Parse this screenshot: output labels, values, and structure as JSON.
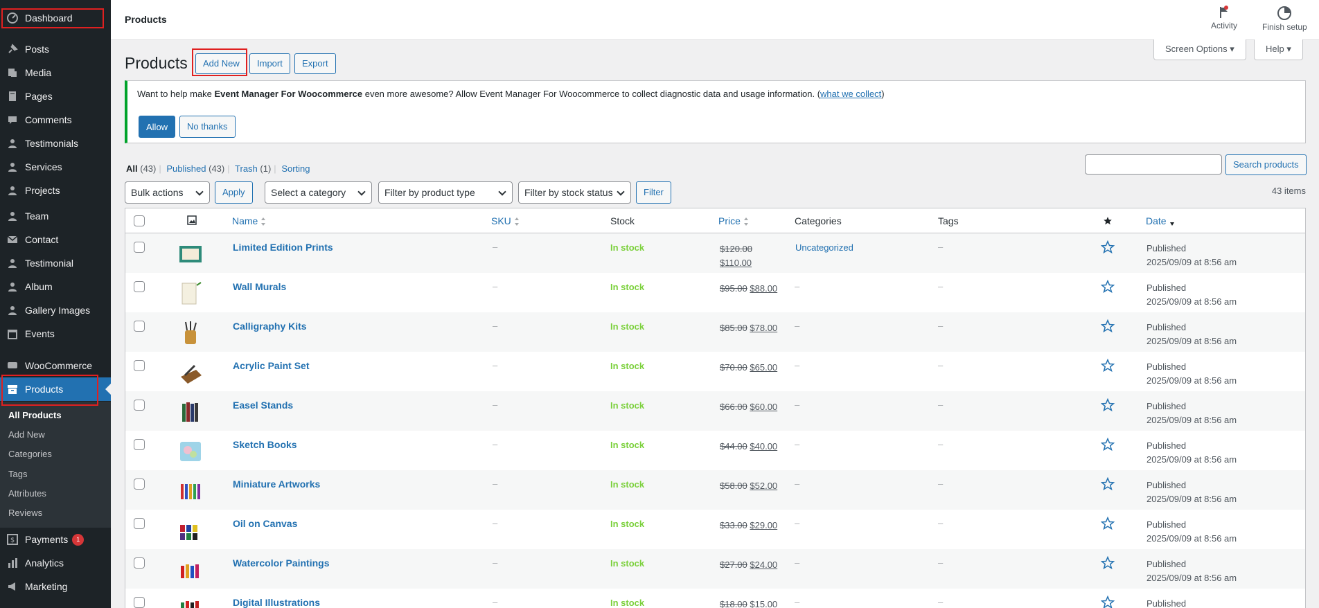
{
  "sidebar": {
    "menu": [
      {
        "label": "Dashboard",
        "icon": "dashboard-icon",
        "top": 0
      },
      {
        "label": "Posts",
        "icon": "pin-icon"
      },
      {
        "label": "Media",
        "icon": "media-icon"
      },
      {
        "label": "Pages",
        "icon": "page-icon"
      },
      {
        "label": "Comments",
        "icon": "comment-icon"
      },
      {
        "label": "Testimonials",
        "icon": "person-icon"
      },
      {
        "label": "Services",
        "icon": "person-icon"
      },
      {
        "label": "Projects",
        "icon": "person-icon"
      },
      {
        "label": "Team",
        "icon": "person-icon"
      },
      {
        "label": "Contact",
        "icon": "mail-icon"
      },
      {
        "label": "Testimonial",
        "icon": "person-icon"
      },
      {
        "label": "Album",
        "icon": "person-icon"
      },
      {
        "label": "Gallery Images",
        "icon": "person-icon"
      },
      {
        "label": "Events",
        "icon": "calendar-icon"
      },
      {
        "label": "WooCommerce",
        "icon": "woo-icon"
      },
      {
        "label": "Products",
        "icon": "archive-icon"
      },
      {
        "label": "Payments",
        "icon": "dollar-icon",
        "badge": "1"
      },
      {
        "label": "Analytics",
        "icon": "bar-chart-icon"
      },
      {
        "label": "Marketing",
        "icon": "megaphone-icon"
      }
    ],
    "submenu": [
      "All Products",
      "Add New",
      "Categories",
      "Tags",
      "Attributes",
      "Reviews"
    ]
  },
  "topbar": {
    "title": "Products",
    "activity": "Activity",
    "finish_setup": "Finish setup"
  },
  "header": {
    "title": "Products",
    "add_new": "Add New",
    "import": "Import",
    "export": "Export",
    "screen_options": "Screen Options",
    "help": "Help"
  },
  "notice": {
    "text_before": "Want to help make ",
    "plugin_name": "Event Manager For Woocommerce",
    "text_after": " even more awesome? Allow Event Manager For Woocommerce to collect diagnostic data and usage information. (",
    "link": "what we collect",
    "close_paren": ")",
    "allow": "Allow",
    "no_thanks": "No thanks"
  },
  "views": {
    "all": "All",
    "all_count": "(43)",
    "published": "Published",
    "published_count": "(43)",
    "trash": "Trash",
    "trash_count": "(1)",
    "sorting": "Sorting"
  },
  "search": {
    "button": "Search products"
  },
  "filters": {
    "bulk_actions": "Bulk actions",
    "apply": "Apply",
    "category": "Select a category",
    "product_type": "Filter by product type",
    "stock_status": "Filter by stock status",
    "filter": "Filter",
    "items_count": "43 items"
  },
  "columns": {
    "name": "Name",
    "sku": "SKU",
    "stock": "Stock",
    "price": "Price",
    "categories": "Categories",
    "tags": "Tags",
    "date": "Date"
  },
  "rows": [
    {
      "name": "Limited Edition Prints",
      "sku": "–",
      "stock": "In stock",
      "regular": "$120.00",
      "sale": "$110.00",
      "categories": "Uncategorized",
      "tags": "–",
      "status": "Published",
      "date": "2025/09/09 at 8:56 am",
      "thumb": "frame"
    },
    {
      "name": "Wall Murals",
      "sku": "–",
      "stock": "In stock",
      "regular": "$95.00",
      "sale": "$88.00",
      "categories": "–",
      "tags": "–",
      "status": "Published",
      "date": "2025/09/09 at 8:56 am",
      "thumb": "notebook"
    },
    {
      "name": "Calligraphy Kits",
      "sku": "–",
      "stock": "In stock",
      "regular": "$85.00",
      "sale": "$78.00",
      "categories": "–",
      "tags": "–",
      "status": "Published",
      "date": "2025/09/09 at 8:56 am",
      "thumb": "pencils"
    },
    {
      "name": "Acrylic Paint Set",
      "sku": "–",
      "stock": "In stock",
      "regular": "$70.00",
      "sale": "$65.00",
      "categories": "–",
      "tags": "–",
      "status": "Published",
      "date": "2025/09/09 at 8:56 am",
      "thumb": "holder"
    },
    {
      "name": "Easel Stands",
      "sku": "–",
      "stock": "In stock",
      "regular": "$66.00",
      "sale": "$60.00",
      "categories": "–",
      "tags": "–",
      "status": "Published",
      "date": "2025/09/09 at 8:56 am",
      "thumb": "books"
    },
    {
      "name": "Sketch Books",
      "sku": "–",
      "stock": "In stock",
      "regular": "$44.00",
      "sale": "$40.00",
      "categories": "–",
      "tags": "–",
      "status": "Published",
      "date": "2025/09/09 at 8:56 am",
      "thumb": "pad"
    },
    {
      "name": "Miniature Artworks",
      "sku": "–",
      "stock": "In stock",
      "regular": "$58.00",
      "sale": "$52.00",
      "categories": "–",
      "tags": "–",
      "status": "Published",
      "date": "2025/09/09 at 8:56 am",
      "thumb": "tubes"
    },
    {
      "name": "Oil on Canvas",
      "sku": "–",
      "stock": "In stock",
      "regular": "$33.00",
      "sale": "$29.00",
      "categories": "–",
      "tags": "–",
      "status": "Published",
      "date": "2025/09/09 at 8:56 am",
      "thumb": "jars"
    },
    {
      "name": "Watercolor Paintings",
      "sku": "–",
      "stock": "In stock",
      "regular": "$27.00",
      "sale": "$24.00",
      "categories": "–",
      "tags": "–",
      "status": "Published",
      "date": "2025/09/09 at 8:56 am",
      "thumb": "bottles"
    },
    {
      "name": "Digital Illustrations",
      "sku": "–",
      "stock": "In stock",
      "regular": "$18.00",
      "sale": "$15.00",
      "categories": "–",
      "tags": "–",
      "status": "Published",
      "date": "",
      "thumb": "bottles2"
    }
  ],
  "colors": {
    "accent": "#2271b1",
    "sidebar": "#1d2327",
    "in_stock": "#7ad03a",
    "highlight": "#e02020"
  }
}
